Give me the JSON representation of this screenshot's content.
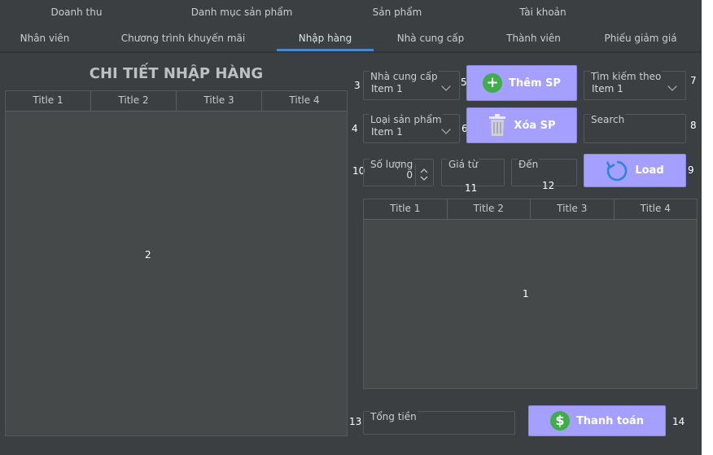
{
  "tabs_row1": [
    "Doanh thu",
    "Danh mục sản phẩm",
    "Sản phẩm",
    "Tài khoản"
  ],
  "tabs_row2": [
    "Nhân viên",
    "Chương trình khuyến mãi",
    "Nhập hàng",
    "Nhà cung cấp",
    "Thành viên",
    "Phiếu giảm giá"
  ],
  "active_tab": "Nhập hàng",
  "left": {
    "title": "CHI TIẾT NHẬP HÀNG",
    "table_headers": [
      "Title 1",
      "Title 2",
      "Title 3",
      "Title 4"
    ],
    "marker": "2"
  },
  "filters": {
    "supplier": {
      "label": "Nhà cung cấp",
      "value": "Item 1",
      "marker": "3"
    },
    "product_type": {
      "label": "Loại sản phẩm",
      "value": "Item 1",
      "marker": "4"
    },
    "search_by": {
      "label": "Tìm kiếm theo",
      "value": "Item 1",
      "marker": "7"
    },
    "search": {
      "label": "Search",
      "marker": "8"
    },
    "quantity": {
      "label": "Số lượng",
      "value": "0",
      "marker": "10"
    },
    "price_from": {
      "label": "Giá từ",
      "marker": "11"
    },
    "price_to": {
      "label": "Đến",
      "marker": "12"
    }
  },
  "buttons": {
    "add": {
      "label": "Thêm SP",
      "marker": "5"
    },
    "delete": {
      "label": "Xóa SP",
      "marker": "6"
    },
    "load": {
      "label": "Load",
      "marker": "9"
    },
    "pay": {
      "label": "Thanh toán",
      "marker": "14"
    }
  },
  "right_table": {
    "headers": [
      "Title 1",
      "Title 2",
      "Title 3",
      "Title 4"
    ],
    "marker": "1"
  },
  "total": {
    "label": "Tổng tiền",
    "marker": "13"
  },
  "colors": {
    "background": "#3c3f41",
    "button": "#a5a0ff",
    "accent": "#4a88c7",
    "green_icon": "#3fae49"
  }
}
